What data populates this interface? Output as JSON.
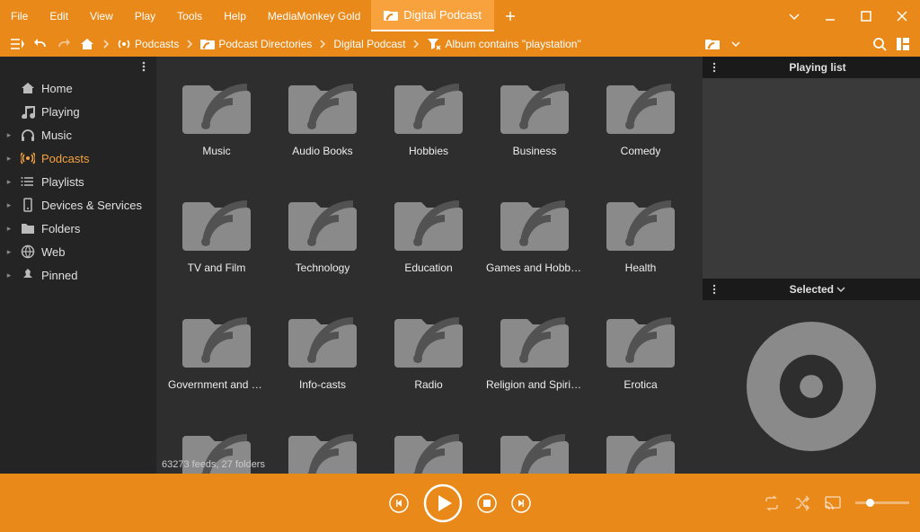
{
  "menu": [
    "File",
    "Edit",
    "View",
    "Play",
    "Tools",
    "Help"
  ],
  "app_name": "MediaMonkey Gold",
  "tab": "Digital Podcast",
  "breadcrumb": {
    "podcasts": "Podcasts",
    "directories": "Podcast Directories",
    "digital": "Digital Podcast",
    "filter": "Album contains \"playstation\""
  },
  "sidebar": [
    {
      "label": "Home",
      "icon": "home",
      "expand": false,
      "active": false
    },
    {
      "label": "Playing",
      "icon": "music-note",
      "expand": false,
      "active": false
    },
    {
      "label": "Music",
      "icon": "headphones",
      "expand": true,
      "active": false
    },
    {
      "label": "Podcasts",
      "icon": "podcast",
      "expand": true,
      "active": true
    },
    {
      "label": "Playlists",
      "icon": "list",
      "expand": true,
      "active": false
    },
    {
      "label": "Devices & Services",
      "icon": "device",
      "expand": true,
      "active": false
    },
    {
      "label": "Folders",
      "icon": "folder",
      "expand": true,
      "active": false
    },
    {
      "label": "Web",
      "icon": "globe",
      "expand": true,
      "active": false
    },
    {
      "label": "Pinned",
      "icon": "pin",
      "expand": true,
      "active": false
    }
  ],
  "folders": [
    "Music",
    "Audio Books",
    "Hobbies",
    "Business",
    "Comedy",
    "TV and Film",
    "Technology",
    "Education",
    "Games and Hobbies",
    "Health",
    "Government and Organizations",
    "Info-casts",
    "Radio",
    "Religion and Spirituality",
    "Erotica",
    "",
    "",
    "",
    "",
    ""
  ],
  "status": "63273 feeds, 27 folders",
  "panels": {
    "playing": "Playing list",
    "selected": "Selected"
  }
}
